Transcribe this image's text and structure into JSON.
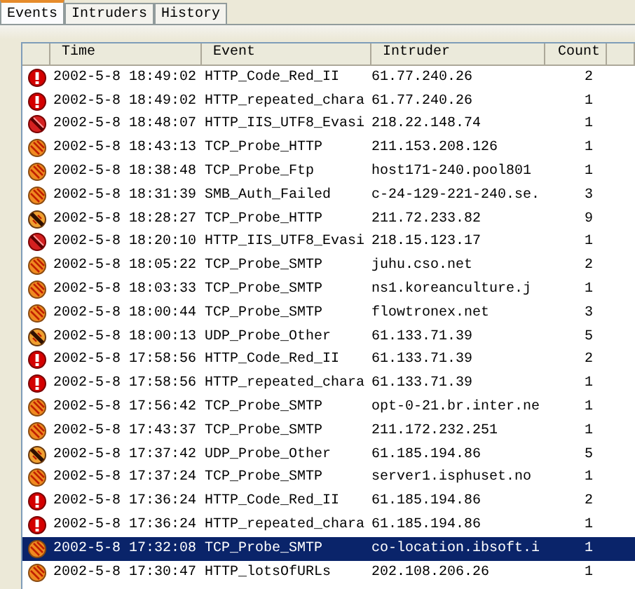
{
  "tabs": [
    {
      "label": "Events",
      "selected": true
    },
    {
      "label": "Intruders",
      "selected": false
    },
    {
      "label": "History",
      "selected": false
    }
  ],
  "table": {
    "columns": [
      "Time",
      "Event",
      "Intruder",
      "Count"
    ],
    "rows": [
      {
        "kind": "critical",
        "time": "2002-5-8 18:49:02",
        "event": "HTTP_Code_Red_II",
        "intruder": "61.77.240.26",
        "count": "2",
        "selected": false
      },
      {
        "kind": "critical",
        "time": "2002-5-8 18:49:02",
        "event": "HTTP_repeated_chara",
        "intruder": "61.77.240.26",
        "count": "1",
        "selected": false
      },
      {
        "kind": "high",
        "time": "2002-5-8 18:48:07",
        "event": "HTTP_IIS_UTF8_Evasi",
        "intruder": "218.22.148.74",
        "count": "1",
        "selected": false
      },
      {
        "kind": "medium",
        "time": "2002-5-8 18:43:13",
        "event": "TCP_Probe_HTTP",
        "intruder": "211.153.208.126",
        "count": "1",
        "selected": false
      },
      {
        "kind": "medium",
        "time": "2002-5-8 18:38:48",
        "event": "TCP_Probe_Ftp",
        "intruder": "host171-240.pool801",
        "count": "1",
        "selected": false
      },
      {
        "kind": "medium",
        "time": "2002-5-8 18:31:39",
        "event": "SMB_Auth_Failed",
        "intruder": "c-24-129-221-240.se.",
        "count": "3",
        "selected": false
      },
      {
        "kind": "low",
        "time": "2002-5-8 18:28:27",
        "event": "TCP_Probe_HTTP",
        "intruder": "211.72.233.82",
        "count": "9",
        "selected": false
      },
      {
        "kind": "high",
        "time": "2002-5-8 18:20:10",
        "event": "HTTP_IIS_UTF8_Evasi",
        "intruder": "218.15.123.17",
        "count": "1",
        "selected": false
      },
      {
        "kind": "medium",
        "time": "2002-5-8 18:05:22",
        "event": "TCP_Probe_SMTP",
        "intruder": "juhu.cso.net",
        "count": "2",
        "selected": false
      },
      {
        "kind": "medium",
        "time": "2002-5-8 18:03:33",
        "event": "TCP_Probe_SMTP",
        "intruder": "ns1.koreanculture.j",
        "count": "1",
        "selected": false
      },
      {
        "kind": "medium",
        "time": "2002-5-8 18:00:44",
        "event": "TCP_Probe_SMTP",
        "intruder": "flowtronex.net",
        "count": "3",
        "selected": false
      },
      {
        "kind": "low",
        "time": "2002-5-8 18:00:13",
        "event": "UDP_Probe_Other",
        "intruder": "61.133.71.39",
        "count": "5",
        "selected": false
      },
      {
        "kind": "critical",
        "time": "2002-5-8 17:58:56",
        "event": "HTTP_Code_Red_II",
        "intruder": "61.133.71.39",
        "count": "2",
        "selected": false
      },
      {
        "kind": "critical",
        "time": "2002-5-8 17:58:56",
        "event": "HTTP_repeated_chara",
        "intruder": "61.133.71.39",
        "count": "1",
        "selected": false
      },
      {
        "kind": "medium",
        "time": "2002-5-8 17:56:42",
        "event": "TCP_Probe_SMTP",
        "intruder": "opt-0-21.br.inter.ne",
        "count": "1",
        "selected": false
      },
      {
        "kind": "medium",
        "time": "2002-5-8 17:43:37",
        "event": "TCP_Probe_SMTP",
        "intruder": "211.172.232.251",
        "count": "1",
        "selected": false
      },
      {
        "kind": "low",
        "time": "2002-5-8 17:37:42",
        "event": "UDP_Probe_Other",
        "intruder": "61.185.194.86",
        "count": "5",
        "selected": false
      },
      {
        "kind": "medium",
        "time": "2002-5-8 17:37:24",
        "event": "TCP_Probe_SMTP",
        "intruder": "server1.isphuset.no",
        "count": "1",
        "selected": false
      },
      {
        "kind": "critical",
        "time": "2002-5-8 17:36:24",
        "event": "HTTP_Code_Red_II",
        "intruder": "61.185.194.86",
        "count": "2",
        "selected": false
      },
      {
        "kind": "critical",
        "time": "2002-5-8 17:36:24",
        "event": "HTTP_repeated_chara",
        "intruder": "61.185.194.86",
        "count": "1",
        "selected": false
      },
      {
        "kind": "medium",
        "time": "2002-5-8 17:32:08",
        "event": "TCP_Probe_SMTP",
        "intruder": "co-location.ibsoft.i",
        "count": "1",
        "selected": true
      },
      {
        "kind": "medium",
        "time": "2002-5-8 17:30:47",
        "event": "HTTP_lotsOfURLs",
        "intruder": "202.108.206.26",
        "count": "1",
        "selected": false
      }
    ]
  }
}
